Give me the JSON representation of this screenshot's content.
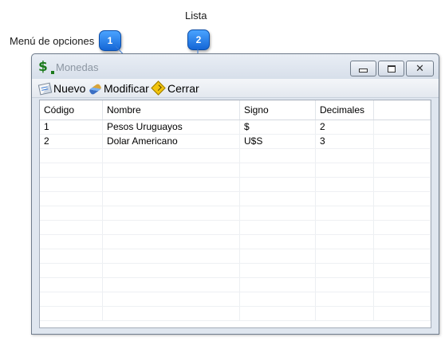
{
  "callouts": {
    "menu": {
      "label": "Menú de opciones",
      "badge": "1"
    },
    "list": {
      "label": "Lista",
      "badge": "2"
    }
  },
  "window": {
    "title": "Monedas",
    "app_icon": "money-icon"
  },
  "menu": {
    "items": [
      {
        "label": "Nuevo",
        "icon": "new-document-icon"
      },
      {
        "label": "Modificar",
        "icon": "edit-pencil-icon"
      },
      {
        "label": "Cerrar",
        "icon": "exit-sign-icon"
      }
    ]
  },
  "table": {
    "columns": [
      "Código",
      "Nombre",
      "Signo",
      "Decimales",
      ""
    ],
    "rows": [
      [
        "1",
        "Pesos Uruguayos",
        "$",
        "2"
      ],
      [
        "2",
        "Dolar Americano",
        "U$S",
        "3"
      ]
    ]
  },
  "colors": {
    "badge": "#1e78e8",
    "title_text": "#8c96a2",
    "window_frame": "#6f7c8c"
  }
}
